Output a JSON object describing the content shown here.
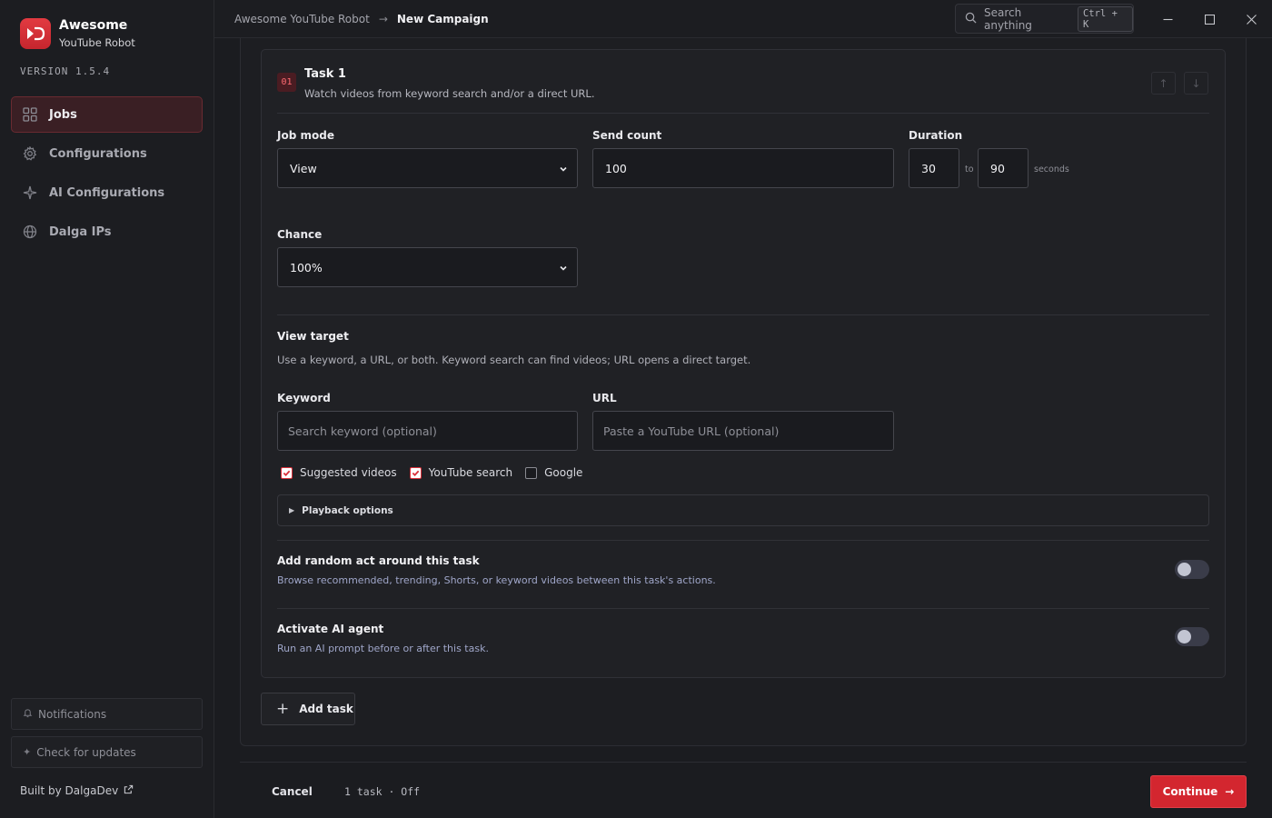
{
  "app": {
    "name_line1": "Awesome",
    "name_line2": "YouTube Robot",
    "version": "VERSION 1.5.4"
  },
  "sidebar": {
    "items": [
      {
        "label": "Jobs",
        "icon": "grid-icon",
        "active": true
      },
      {
        "label": "Configurations",
        "icon": "gear-icon",
        "active": false
      },
      {
        "label": "AI Configurations",
        "icon": "sparkle-icon",
        "active": false
      },
      {
        "label": "Dalga IPs",
        "icon": "globe-icon",
        "active": false
      }
    ],
    "notifications": "Notifications",
    "check_updates": "Check for updates",
    "built_by": "Built by DalgaDev"
  },
  "topbar": {
    "breadcrumb_root": "Awesome YouTube Robot",
    "breadcrumb_current": "New Campaign",
    "search_placeholder": "Search anything",
    "search_shortcut": "Ctrl + K"
  },
  "task": {
    "number": "01",
    "title": "Task 1",
    "subtitle": "Watch videos from keyword search and/or a direct URL.",
    "job_mode_label": "Job mode",
    "job_mode_value": "View",
    "send_count_label": "Send count",
    "send_count_value": "100",
    "duration_label": "Duration",
    "duration_min": "30",
    "duration_to": "to",
    "duration_max": "90",
    "duration_unit": "seconds",
    "chance_label": "Chance",
    "chance_value": "100%",
    "view_target_title": "View target",
    "view_target_desc": "Use a keyword, a URL, or both. Keyword search can find videos; URL opens a direct target.",
    "keyword_label": "Keyword",
    "keyword_placeholder": "Search keyword (optional)",
    "url_label": "URL",
    "url_placeholder": "Paste a YouTube URL (optional)",
    "checkboxes": [
      {
        "label": "Suggested videos",
        "checked": true
      },
      {
        "label": "YouTube search",
        "checked": true
      },
      {
        "label": "Google",
        "checked": false
      }
    ],
    "playback_options": "Playback options",
    "random_act_title": "Add random act around this task",
    "random_act_desc": "Browse recommended, trending, Shorts, or keyword videos between this task's actions.",
    "random_act_on": false,
    "ai_agent_title": "Activate AI agent",
    "ai_agent_desc": "Run an AI prompt before or after this task.",
    "ai_agent_on": false
  },
  "actions": {
    "add_task": "Add task",
    "cancel": "Cancel",
    "summary": "1 task · Off",
    "continue": "Continue"
  },
  "colors": {
    "accent": "#d3262f",
    "background": "#1b1c20"
  }
}
